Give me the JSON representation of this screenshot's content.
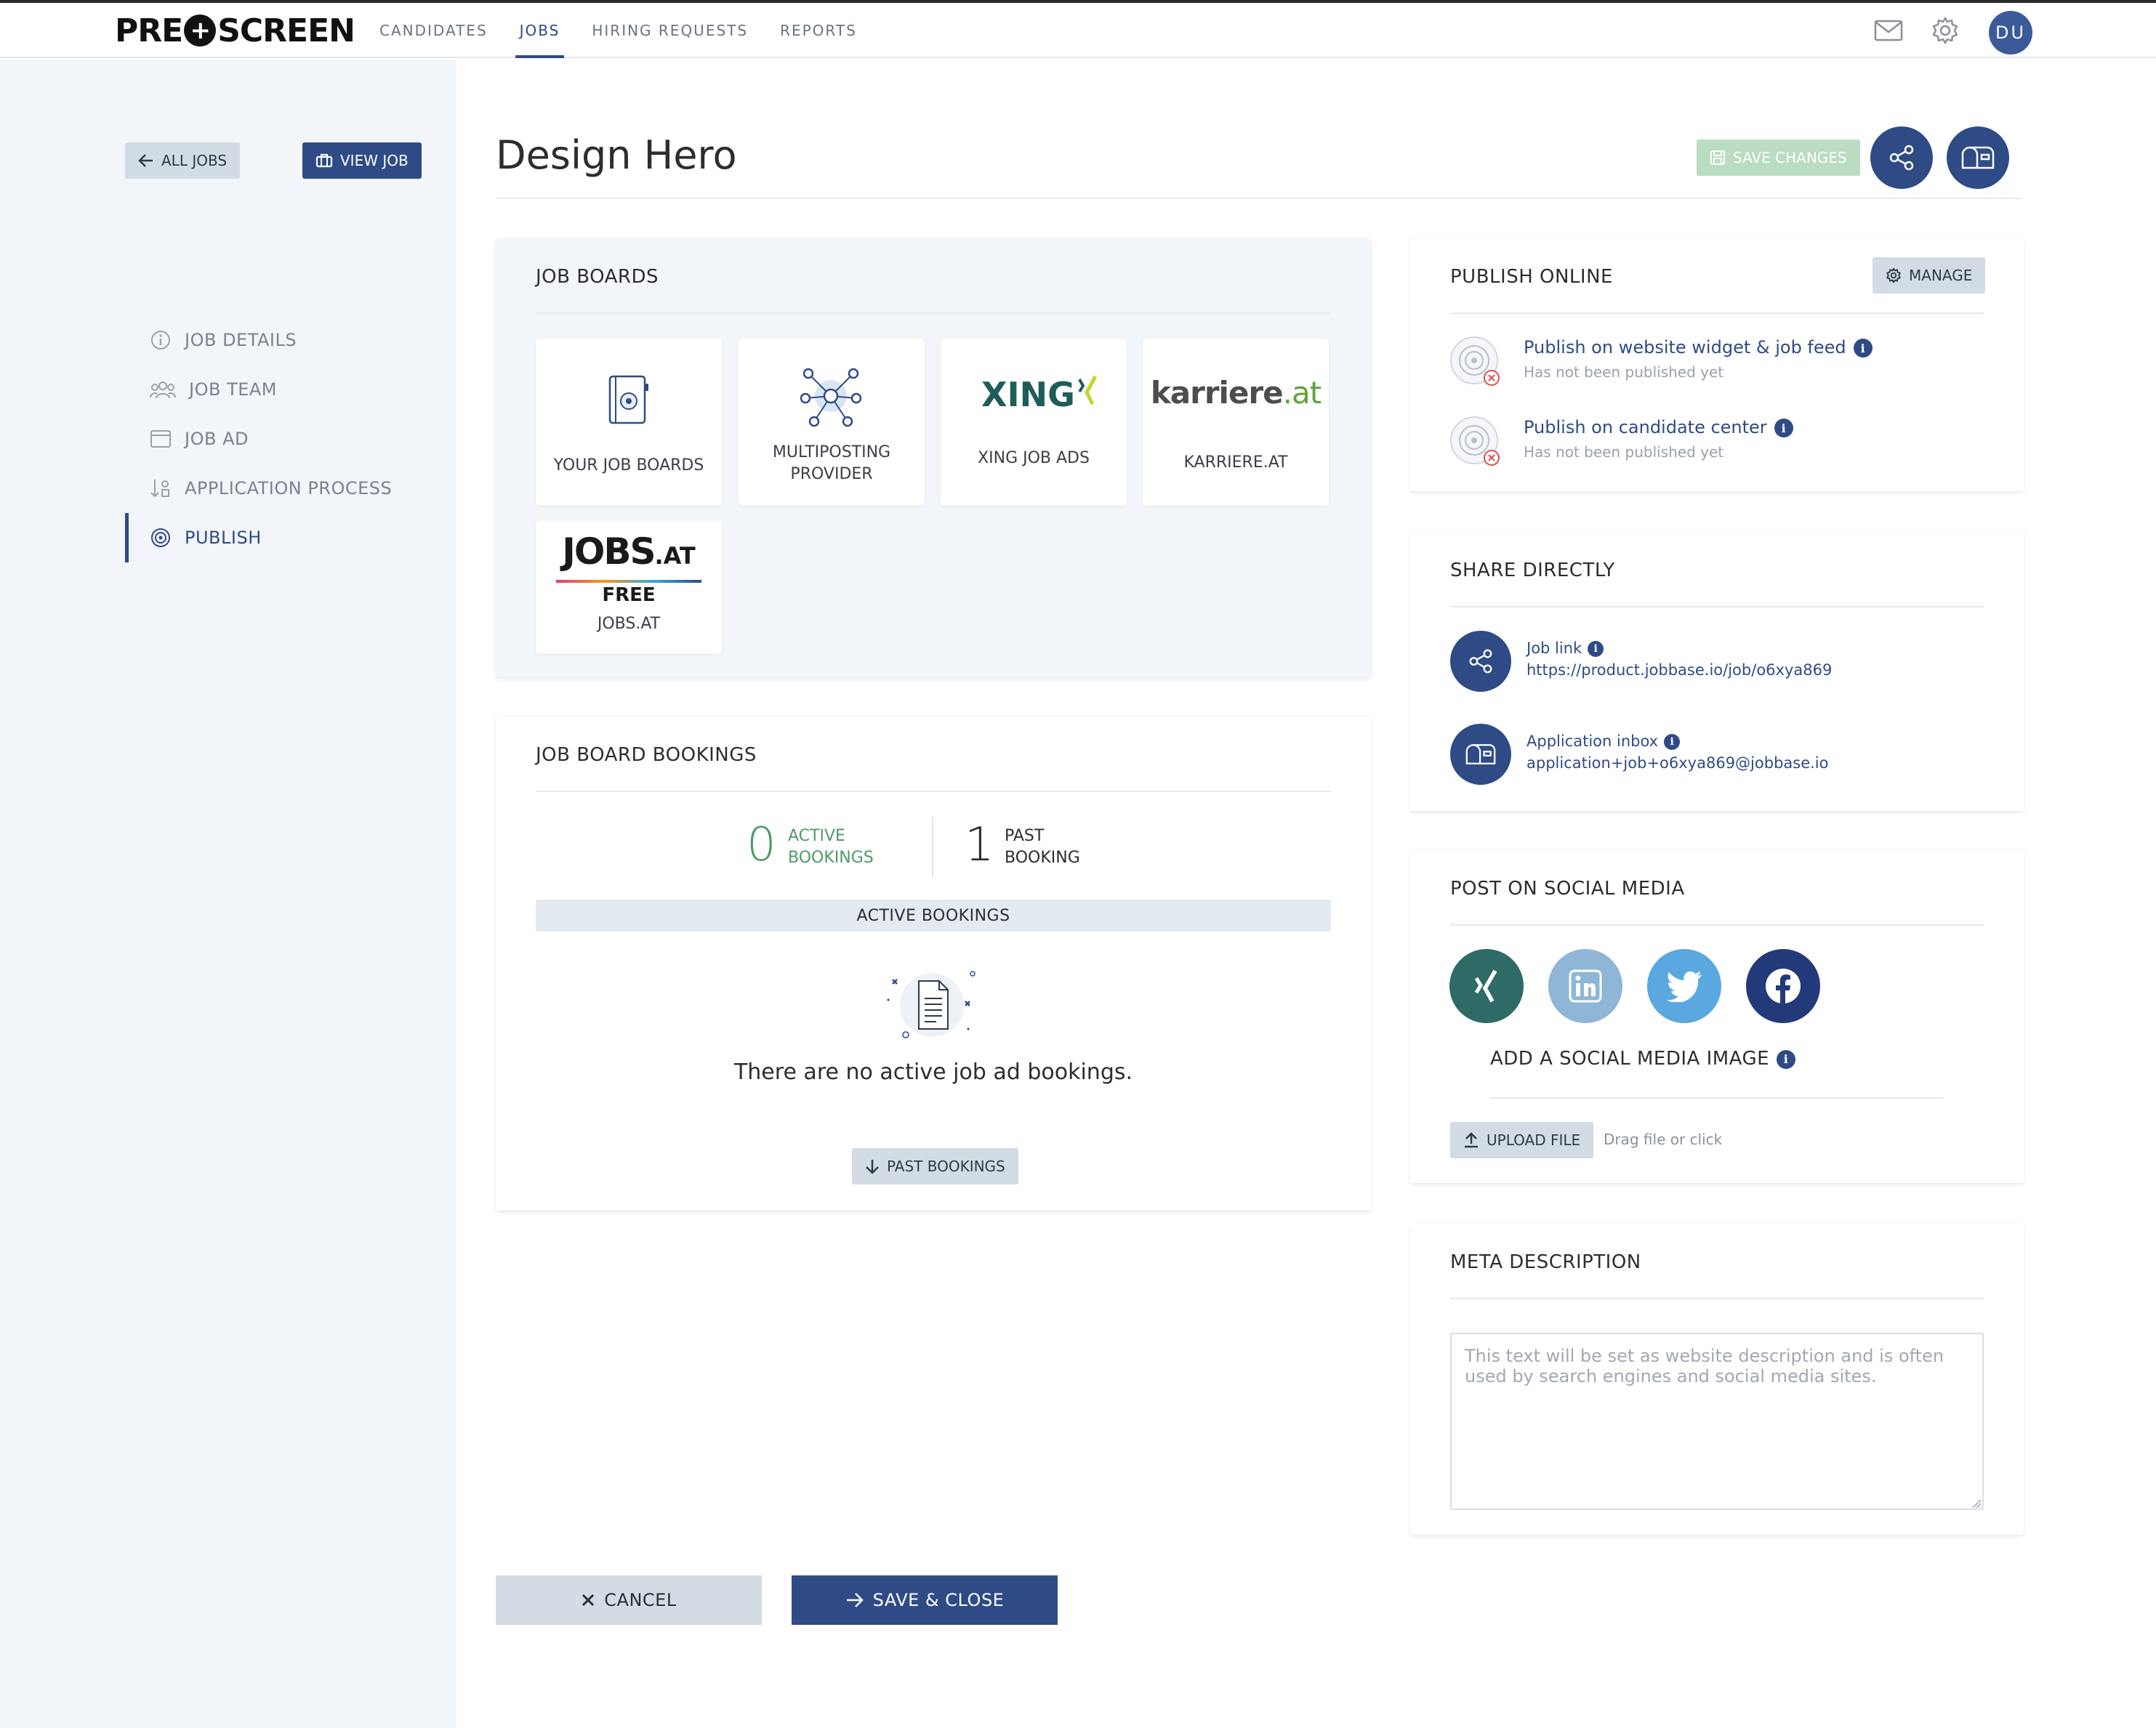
{
  "brand": {
    "logo_left": "PRE",
    "logo_mark": "+",
    "logo_right": "SCREEN"
  },
  "nav": {
    "items": [
      "CANDIDATES",
      "JOBS",
      "HIRING REQUESTS",
      "REPORTS"
    ],
    "active": "JOBS"
  },
  "user": {
    "initials": "DU"
  },
  "sidebar": {
    "all_jobs": "ALL JOBS",
    "view_job": "VIEW JOB",
    "items": [
      "JOB DETAILS",
      "JOB TEAM",
      "JOB AD",
      "APPLICATION PROCESS",
      "PUBLISH"
    ],
    "active": "PUBLISH"
  },
  "header": {
    "title": "Design Hero",
    "save_changes": "SAVE CHANGES"
  },
  "job_boards": {
    "title": "JOB BOARDS",
    "tiles": [
      {
        "label": "YOUR JOB BOARDS"
      },
      {
        "label_line1": "MULTIPOSTING",
        "label_line2": "PROVIDER"
      },
      {
        "logo": "XING",
        "label": "XING JOB ADS"
      },
      {
        "logo": "karriere",
        "logo_suffix": ".at",
        "label": "KARRIERE.AT"
      },
      {
        "logo": "JOBS",
        "logo_suffix": ".AT",
        "badge": "FREE",
        "label": "JOBS.AT"
      }
    ]
  },
  "bookings": {
    "title": "JOB BOARD BOOKINGS",
    "active_count": "0",
    "active_label_1": "ACTIVE",
    "active_label_2": "BOOKINGS",
    "past_count": "1",
    "past_label_1": "PAST",
    "past_label_2": "BOOKING",
    "bar_label": "ACTIVE BOOKINGS",
    "empty_text": "There are no active job ad bookings.",
    "past_button": "PAST BOOKINGS"
  },
  "publish_online": {
    "title": "PUBLISH ONLINE",
    "manage": "MANAGE",
    "rows": [
      {
        "title": "Publish on website widget & job feed",
        "status": "Has not been published yet"
      },
      {
        "title": "Publish on candidate center",
        "status": "Has not been published yet"
      }
    ]
  },
  "share": {
    "title": "SHARE DIRECTLY",
    "job_link_label": "Job link",
    "job_link_url": "https://product.jobbase.io/job/o6xya869",
    "inbox_label": "Application inbox",
    "inbox_email": "application+job+o6xya869@jobbase.io"
  },
  "social": {
    "title": "POST ON SOCIAL MEDIA",
    "networks": [
      {
        "name": "xing",
        "color": "#2f6b66"
      },
      {
        "name": "linkedin",
        "color": "#8fb6d6"
      },
      {
        "name": "twitter",
        "color": "#5aa8df"
      },
      {
        "name": "facebook",
        "color": "#233a7a"
      }
    ],
    "image_title": "ADD A SOCIAL MEDIA IMAGE",
    "upload_button": "UPLOAD FILE",
    "upload_hint": "Drag file or click"
  },
  "meta": {
    "title": "META DESCRIPTION",
    "placeholder": "This text will be set as website description and is often used by search engines and social media sites."
  },
  "actions": {
    "cancel": "CANCEL",
    "save_close": "SAVE & CLOSE"
  },
  "colors": {
    "primary": "#2f4b86",
    "success": "#4f9a68",
    "sidebar_bg": "#f2f5f9"
  }
}
